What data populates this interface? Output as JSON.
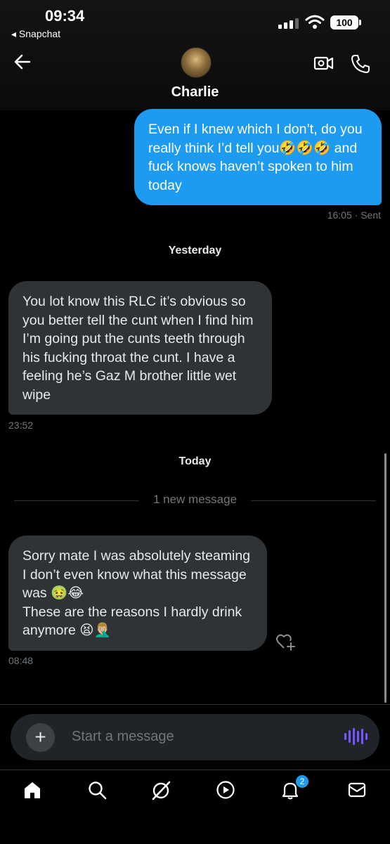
{
  "status_bar": {
    "time": "09:34",
    "back_app": "◂ Snapchat",
    "battery": "100"
  },
  "header": {
    "contact_name": "Charlie"
  },
  "messages": {
    "sent_1": {
      "text": "Even if I knew which I don’t, do you really think I’d tell you🤣🤣🤣 and fuck knows haven’t spoken to him today",
      "meta": "16:05 · Sent"
    },
    "separator_yesterday": "Yesterday",
    "received_1": {
      "text": "You lot know this RLC it’s obvious so you better tell the cunt when I find him I’m going put the cunts teeth through his fucking throat the cunt. I have a feeling he’s Gaz M brother little wet wipe",
      "time": "23:52"
    },
    "separator_today": "Today",
    "new_message_label": "1 new message",
    "received_2": {
      "text_line1": "Sorry mate I was absolutely steaming I don’t even know what this message was 🤢😂",
      "text_line2": "These are the reasons I hardly drink anymore 😫🤦🏼‍♂️",
      "time": "08:48"
    }
  },
  "composer": {
    "placeholder": "Start a message"
  },
  "tabbar": {
    "notifications_badge": "2",
    "tabs": [
      "home-icon",
      "search-icon",
      "grok-icon",
      "video-icon",
      "notifications-icon",
      "messages-icon"
    ]
  },
  "colors": {
    "accent": "#1d9bf0",
    "bubble_received": "#2f3336",
    "voice": "#7856ff"
  }
}
